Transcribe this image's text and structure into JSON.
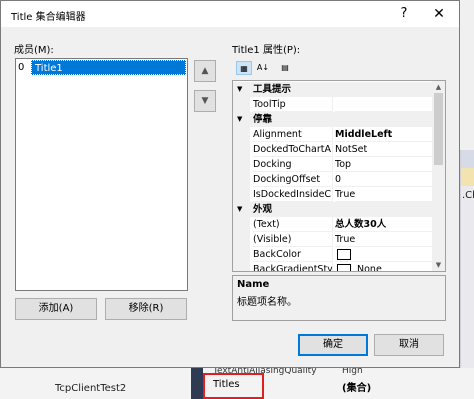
{
  "dialog": {
    "title": "Title 集合编辑器",
    "help": "?",
    "close": "✕"
  },
  "members": {
    "label": "成员(M):",
    "items": [
      {
        "index": "0",
        "name": "Title1"
      }
    ],
    "up_icon": "up-arrow-icon",
    "down_icon": "down-arrow-icon",
    "add_label": "添加(A)",
    "remove_label": "移除(R)"
  },
  "properties": {
    "label": "Title1 属性(P):",
    "toolbar": [
      "categorized-icon",
      "alphabetical-icon",
      "property-pages-icon"
    ],
    "categories": [
      {
        "name": "工具提示",
        "rows": [
          {
            "name": "ToolTip",
            "value": ""
          }
        ]
      },
      {
        "name": "停靠",
        "rows": [
          {
            "name": "Alignment",
            "value": "MiddleLeft",
            "bold": true
          },
          {
            "name": "DockedToChartA",
            "value": "NotSet"
          },
          {
            "name": "Docking",
            "value": "Top"
          },
          {
            "name": "DockingOffset",
            "value": "0"
          },
          {
            "name": "IsDockedInsideC",
            "value": "True"
          }
        ]
      },
      {
        "name": "外观",
        "rows": [
          {
            "name": "(Text)",
            "value": "总人数30人",
            "bold": true
          },
          {
            "name": "(Visible)",
            "value": "True"
          },
          {
            "name": "BackColor",
            "value": "",
            "swatch": true
          },
          {
            "name": "BackGradientStyl",
            "value": "None",
            "swatch": true
          }
        ]
      }
    ],
    "description": {
      "title": "Name",
      "text": "标题项名称。"
    }
  },
  "buttons": {
    "ok": "确定",
    "cancel": "取消"
  },
  "background": {
    "right_text": ".Cha",
    "project": "TcpClientTest2",
    "prop_partial": "TextAntiAliasingQuality",
    "prop_partial_value": "High",
    "prop_titles": "Titles",
    "prop_titles_value": "(集合)"
  },
  "colors": {
    "selection": "#0078d7",
    "highlight": "#e02020"
  }
}
